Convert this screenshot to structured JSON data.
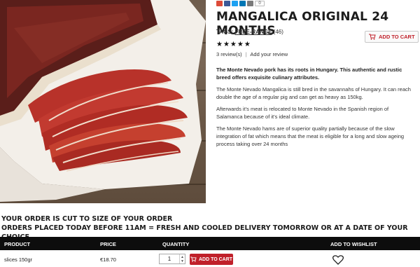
{
  "product": {
    "title": "MANGALICA ORIGINAL 24 MONTHS",
    "tags_label": "TAGS:",
    "tag": "FREE-RANGE",
    "tag_count": "(46)",
    "share_count": "0",
    "add_to_cart_label": "ADD TO CART",
    "rating_stars": "★★★★★",
    "reviews_label": "3 review(s)",
    "review_separator": "|",
    "add_review_label": "Add your review",
    "description": [
      "The Monte Nevado pork has its roots in Hungary. This authentic and rustic breed offers exquisite culinary attributes.",
      "The Monte Nevado Mangalica is still bred in the savannahs of Hungary. It can reach double the age of a regular pig and can get as heavy as 150kg.",
      "Afterwards it's meat is relocated to Monte Nevado in the Spanish region of Salamanca because of it's ideal climate.",
      "The Monte Nevado hams are of superior quality partially because of the slow integration of fat which means that the meat is eligible for a long and slow ageing process taking over 24 months"
    ]
  },
  "order_notice": {
    "line1": "YOUR ORDER IS CUT TO SIZE OF YOUR ORDER",
    "line2": "ORDERS PLACED TODAY BEFORE 11AM = FRESH AND COOLED DELIVERY TOMORROW OR AT A DATE OF YOUR CHOICE"
  },
  "table": {
    "headers": [
      "PRODUCT",
      "PRICE",
      "QUANTITY",
      "ADD TO WISHLIST"
    ],
    "row": {
      "product": "slices 150gr",
      "price": "€18.70",
      "quantity": "1",
      "add_to_cart_label": "ADD TO CART"
    }
  },
  "colors": {
    "accent": "#c0202a",
    "header_bg": "#0d0d0d"
  },
  "icons": [
    "google-plus-icon",
    "facebook-icon",
    "twitter-icon",
    "linkedin-icon",
    "email-icon",
    "cart-icon",
    "heart-icon",
    "stepper-arrows-icon"
  ]
}
